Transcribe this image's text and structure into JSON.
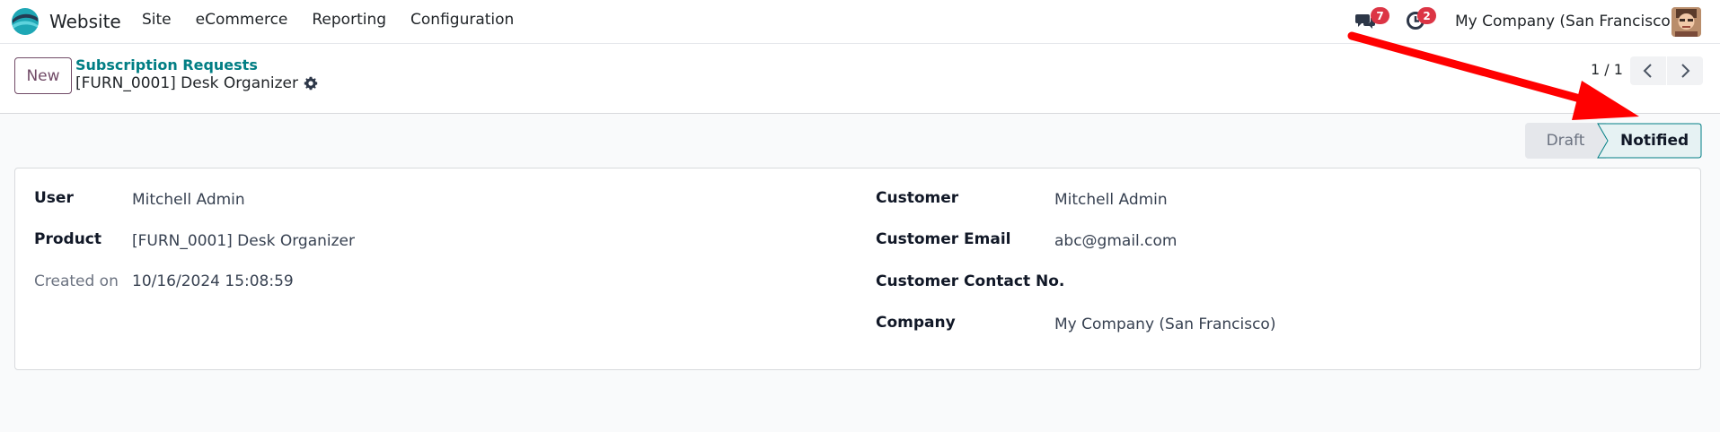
{
  "navbar": {
    "brand": "Website",
    "menu": [
      "Site",
      "eCommerce",
      "Reporting",
      "Configuration"
    ],
    "messages_count": "7",
    "activities_count": "2",
    "company": "My Company (San Francisco)"
  },
  "control_panel": {
    "new_label": "New",
    "breadcrumb_parent": "Subscription Requests",
    "breadcrumb_current": "[FURN_0001] Desk Organizer",
    "pager": "1 / 1"
  },
  "status": {
    "stages": [
      "Draft",
      "Notified"
    ],
    "active": "Notified"
  },
  "form": {
    "left": [
      {
        "label": "User",
        "value": "Mitchell Admin"
      },
      {
        "label": "Product",
        "value": "[FURN_0001] Desk Organizer"
      },
      {
        "label": "Created on",
        "value": "10/16/2024 15:08:59"
      }
    ],
    "right": [
      {
        "label": "Customer",
        "value": "Mitchell Admin"
      },
      {
        "label": "Customer Email",
        "value": "abc@gmail.com"
      },
      {
        "label": "Customer Contact No.",
        "value": ""
      },
      {
        "label": "Company",
        "value": "My Company (San Francisco)"
      }
    ]
  },
  "colors": {
    "brand_primary": "#714b67",
    "link": "#017e84",
    "badge": "#dc3545",
    "status_active_bg": "#e6f2f3",
    "annotation": "#ff0000"
  },
  "icons": {
    "brand": "website-logo-icon",
    "messages": "chat-bubbles-icon",
    "activities": "clock-icon",
    "settings": "gear-icon",
    "prev": "chevron-left-icon",
    "next": "chevron-right-icon"
  }
}
